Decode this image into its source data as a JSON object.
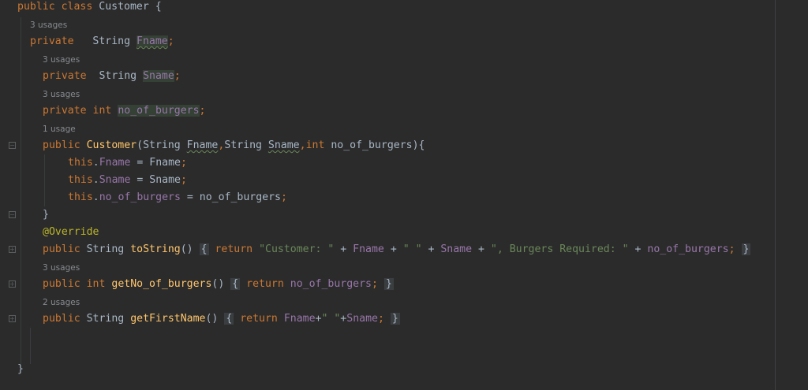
{
  "code": {
    "class_decl": {
      "kw1": "public",
      "kw2": "class",
      "name": "Customer",
      "brace": "{"
    },
    "field1": {
      "usages": "3 usages",
      "kw": "private",
      "type": "String",
      "name": "Fname",
      "semi": ";"
    },
    "field2": {
      "usages": "3 usages",
      "kw": "private",
      "type": "String",
      "name": "Sname",
      "semi": ";"
    },
    "field3": {
      "usages": "3 usages",
      "kw": "private",
      "type": "int",
      "name": "no_of_burgers",
      "semi": ";"
    },
    "ctor": {
      "usages": "1 usage",
      "kw": "public",
      "name": "Customer",
      "p_open": "(",
      "t1": "String",
      "a1": "Fname",
      "c1": ",",
      "t2": "String",
      "a2": "Sname",
      "c2": ",",
      "t3": "int",
      "a3": "no_of_burgers",
      "p_close": "){",
      "body": [
        {
          "this": "this",
          "dot": ".",
          "field": "Fname",
          "eq": " = ",
          "val": "Fname",
          "semi": ";"
        },
        {
          "this": "this",
          "dot": ".",
          "field": "Sname",
          "eq": " = ",
          "val": "Sname",
          "semi": ";"
        },
        {
          "this": "this",
          "dot": ".",
          "field": "no_of_burgers",
          "eq": " = ",
          "val": "no_of_burgers",
          "semi": ";"
        }
      ],
      "close": "}"
    },
    "tostring": {
      "annotation": "@Override",
      "kw": "public",
      "type": "String",
      "name": "toString",
      "parens": "()",
      "open": "{",
      "ret": "return",
      "s1": "\"Customer: \"",
      "plus": " + ",
      "f1": "Fname",
      "s2": "\" \"",
      "f2": "Sname",
      "s3": "\", Burgers Required: \"",
      "f3": "no_of_burgers",
      "semi": ";",
      "close": "}"
    },
    "getburgers": {
      "usages": "3 usages",
      "kw": "public",
      "type": "int",
      "name": "getNo_of_burgers",
      "parens": "()",
      "open": "{",
      "ret": "return",
      "f": "no_of_burgers",
      "semi": ";",
      "close": "}"
    },
    "getfirst": {
      "usages": "2 usages",
      "kw": "public",
      "type": "String",
      "name": "getFirstName",
      "parens": "()",
      "open": "{",
      "ret": "return",
      "f1": "Fname",
      "plus": "+",
      "s": "\" \"",
      "f2": "Sname",
      "semi": ";",
      "close": "}"
    },
    "class_close": "}"
  },
  "colors": {
    "background": "#2b2b2b",
    "keyword": "#cc7832",
    "field": "#9876aa",
    "method": "#ffc66d",
    "string": "#6a8759",
    "annotation": "#bbb529",
    "plain": "#a9b7c6",
    "hint": "#868a8f"
  }
}
